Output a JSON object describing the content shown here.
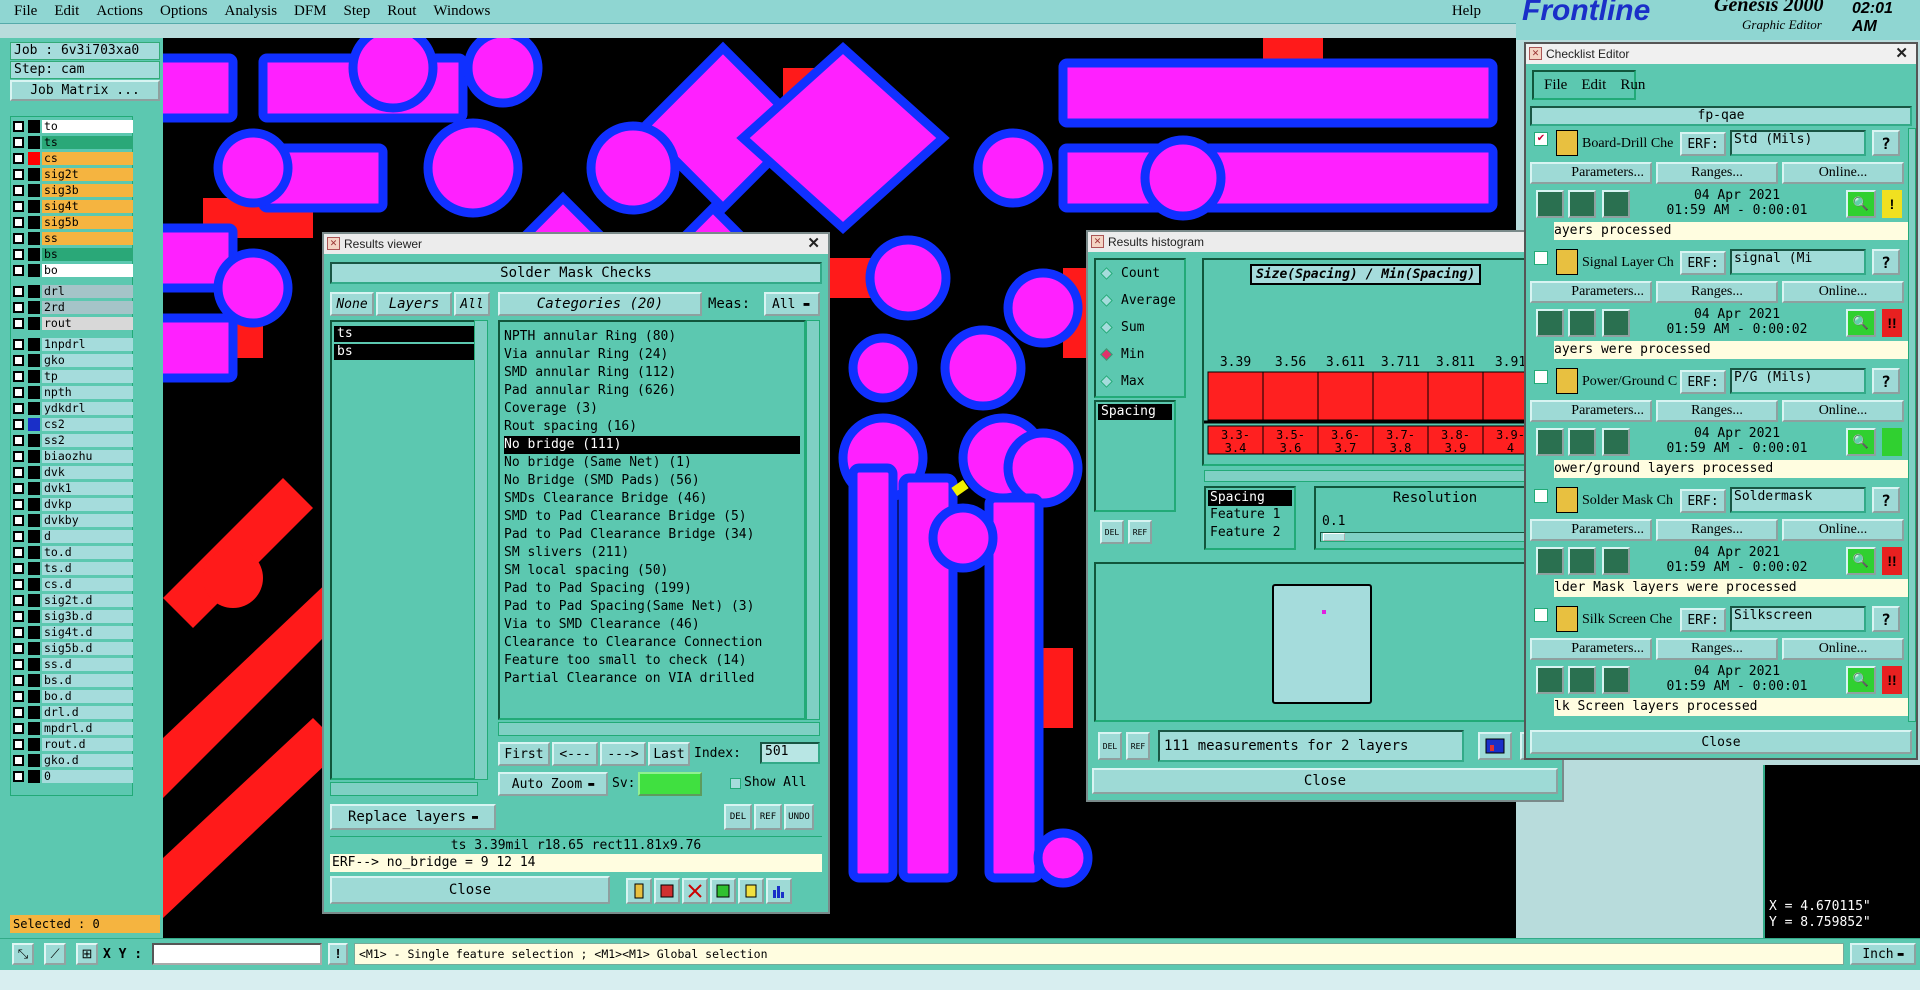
{
  "menubar": {
    "items": [
      "File",
      "Edit",
      "Actions",
      "Options",
      "Analysis",
      "DFM",
      "Step",
      "Rout",
      "Windows"
    ],
    "help": "Help"
  },
  "brand": {
    "logo": "Frontline",
    "product": "Genesis 2000",
    "subtitle": "Graphic Editor",
    "time": "02:01 AM"
  },
  "left": {
    "job": "Job : 6v3i703xa0",
    "step": "Step: cam",
    "job_matrix": "Job Matrix ...",
    "layers": [
      {
        "name": "to",
        "color": "#ffffff",
        "swatch": "#000000"
      },
      {
        "name": "ts",
        "color": "#2aa878",
        "swatch": "#000000"
      },
      {
        "name": "cs",
        "color": "#f5b440",
        "swatch": "#ff0000"
      },
      {
        "name": "sig2t",
        "color": "#f5b440",
        "swatch": "#000000"
      },
      {
        "name": "sig3b",
        "color": "#f5b440",
        "swatch": "#000000"
      },
      {
        "name": "sig4t",
        "color": "#f5b440",
        "swatch": "#000000"
      },
      {
        "name": "sig5b",
        "color": "#f5b440",
        "swatch": "#000000"
      },
      {
        "name": "ss",
        "color": "#f5b440",
        "swatch": "#000000"
      },
      {
        "name": "bs",
        "color": "#2aa878",
        "swatch": "#000000"
      },
      {
        "name": "bo",
        "color": "#ffffff",
        "swatch": "#000000"
      },
      {
        "name": "drl",
        "color": "#a5c4c8",
        "swatch": "#000000"
      },
      {
        "name": "2rd",
        "color": "#a5c4c8",
        "swatch": "#000000"
      },
      {
        "name": "rout",
        "color": "#d8d8d8",
        "swatch": "#000000"
      },
      {
        "name": "1npdrl",
        "color": "#a5dcdc",
        "swatch": "#000000"
      },
      {
        "name": "gko",
        "color": "#a5dcdc",
        "swatch": "#000000"
      },
      {
        "name": "tp",
        "color": "#a5dcdc",
        "swatch": "#000000"
      },
      {
        "name": "npth",
        "color": "#a5dcdc",
        "swatch": "#000000"
      },
      {
        "name": "ydkdrl",
        "color": "#a5dcdc",
        "swatch": "#000000"
      },
      {
        "name": "cs2",
        "color": "#a5dcdc",
        "swatch": "#1a2fc8"
      },
      {
        "name": "ss2",
        "color": "#a5dcdc",
        "swatch": "#000000"
      },
      {
        "name": "biaozhu",
        "color": "#a5dcdc",
        "swatch": "#000000"
      },
      {
        "name": "dvk",
        "color": "#a5dcdc",
        "swatch": "#000000"
      },
      {
        "name": "dvk1",
        "color": "#a5dcdc",
        "swatch": "#000000"
      },
      {
        "name": "dvkp",
        "color": "#a5dcdc",
        "swatch": "#000000"
      },
      {
        "name": "dvkby",
        "color": "#a5dcdc",
        "swatch": "#000000"
      },
      {
        "name": "d",
        "color": "#a5dcdc",
        "swatch": "#000000"
      },
      {
        "name": "to.d",
        "color": "#a5dcdc",
        "swatch": "#000000"
      },
      {
        "name": "ts.d",
        "color": "#a5dcdc",
        "swatch": "#000000"
      },
      {
        "name": "cs.d",
        "color": "#a5dcdc",
        "swatch": "#000000"
      },
      {
        "name": "sig2t.d",
        "color": "#a5dcdc",
        "swatch": "#000000"
      },
      {
        "name": "sig3b.d",
        "color": "#a5dcdc",
        "swatch": "#000000"
      },
      {
        "name": "sig4t.d",
        "color": "#a5dcdc",
        "swatch": "#000000"
      },
      {
        "name": "sig5b.d",
        "color": "#a5dcdc",
        "swatch": "#000000"
      },
      {
        "name": "ss.d",
        "color": "#a5dcdc",
        "swatch": "#000000"
      },
      {
        "name": "bs.d",
        "color": "#a5dcdc",
        "swatch": "#000000"
      },
      {
        "name": "bo.d",
        "color": "#a5dcdc",
        "swatch": "#000000"
      },
      {
        "name": "drl.d",
        "color": "#a5dcdc",
        "swatch": "#000000"
      },
      {
        "name": "mpdrl.d",
        "color": "#a5dcdc",
        "swatch": "#000000"
      },
      {
        "name": "rout.d",
        "color": "#a5dcdc",
        "swatch": "#000000"
      },
      {
        "name": "gko.d",
        "color": "#a5dcdc",
        "swatch": "#000000"
      },
      {
        "name": "0",
        "color": "#a5dcdc",
        "swatch": "#000000"
      }
    ],
    "selected": "Selected : 0"
  },
  "results_viewer": {
    "title": "Results viewer",
    "header": "Solder Mask Checks",
    "none_btn": "None",
    "layers_btn": "Layers",
    "all_btn": "All",
    "layers": [
      "ts",
      "bs"
    ],
    "categories_btn": "Categories (20)",
    "meas_label": "Meas:",
    "meas_value": "All",
    "categories": [
      "NPTH annular Ring (80)",
      "Via annular Ring (24)",
      "SMD annular Ring (112)",
      "Pad annular Ring (626)",
      "Coverage (3)",
      "Rout spacing (16)",
      "No bridge (111)",
      "No bridge (Same Net) (1)",
      "No Bridge (SMD Pads) (56)",
      "SMDs Clearance Bridge (46)",
      "SMD to Pad Clearance Bridge (5)",
      "Pad to Pad Clearance Bridge (34)",
      "SM slivers (211)",
      "SM local spacing (50)",
      "Pad to Pad Spacing (199)",
      "Pad to Pad Spacing(Same Net) (3)",
      "Via to SMD Clearance (46)",
      "Clearance to Clearance Connection",
      "Feature too small to check (14)",
      "Partial Clearance on VIA drilled"
    ],
    "selected_category": "No bridge (111)",
    "nav": {
      "first": "First",
      "prev": "<---",
      "next": "--->",
      "last": "Last",
      "index_label": "Index:",
      "index_value": "501"
    },
    "auto_zoom": "Auto Zoom",
    "sv_label": "Sv:",
    "show_all": "Show All",
    "replace_layers": "Replace layers",
    "info_line": "ts 3.39mil  r18.65  rect11.81x9.76",
    "erf_line": "ERF--> no_bridge = 9 12 14",
    "close": "Close"
  },
  "histogram": {
    "title": "Results histogram",
    "modes": [
      "Count",
      "Average",
      "Sum",
      "Min",
      "Max"
    ],
    "selected_mode": "Min",
    "list_item": "Spacing",
    "chart_title": "Size(Spacing) / Min(Spacing)",
    "feature_list": [
      "Spacing",
      "Feature 1",
      "Feature 2"
    ],
    "resolution_label": "Resolution",
    "resolution_value": "0.1",
    "status": "111 measurements for 2 layers",
    "close": "Close"
  },
  "chart_data": {
    "type": "bar",
    "title": "Size(Spacing) / Min(Spacing)",
    "categories": [
      "3.3-3.4",
      "3.5-3.6",
      "3.6-3.7",
      "3.7-3.8",
      "3.8-3.9",
      "3.9-4"
    ],
    "bar_labels": [
      "3.39",
      "3.56",
      "3.611",
      "3.711",
      "3.811",
      "3.91"
    ],
    "values": [
      3.39,
      3.56,
      3.611,
      3.711,
      3.811,
      3.91
    ],
    "bar_color": "#ff2020"
  },
  "checklist": {
    "title": "Checklist Editor",
    "menu": [
      "File",
      "Edit",
      "Run"
    ],
    "name": "fp-qae",
    "erf_label": "ERF:",
    "params": "Parameters...",
    "ranges": "Ranges...",
    "online": "Online...",
    "close": "Close",
    "checks": [
      {
        "name": "Board-Drill Che",
        "erf": "Std (Mils)",
        "date": "04 Apr 2021",
        "time": "01:59 AM - 0:00:01",
        "status": "ayers processed",
        "flag": "#f0e020",
        "flag_text": "!"
      },
      {
        "name": "Signal Layer Ch",
        "erf": "signal (Mi",
        "date": "04 Apr 2021",
        "time": "01:59 AM - 0:00:02",
        "status": "ayers were processed",
        "flag": "#e82020",
        "flag_text": "!!"
      },
      {
        "name": "Power/Ground C",
        "erf": "P/G (Mils)",
        "date": "04 Apr 2021",
        "time": "01:59 AM - 0:00:01",
        "status": "ower/ground layers processed",
        "flag": "#30d030",
        "flag_text": ""
      },
      {
        "name": "Solder Mask Ch",
        "erf": "Soldermask",
        "date": "04 Apr 2021",
        "time": "01:59 AM - 0:00:02",
        "status": "lder Mask layers were processed",
        "flag": "#e82020",
        "flag_text": "!!"
      },
      {
        "name": "Silk Screen Che",
        "erf": "Silkscreen",
        "date": "04 Apr 2021",
        "time": "01:59 AM - 0:00:01",
        "status": "lk Screen layers processed",
        "flag": "#e82020",
        "flag_text": "!!"
      }
    ]
  },
  "coords": {
    "x": "X = 4.670115\"",
    "y": "Y = 8.759852\""
  },
  "status": {
    "xy_label": "X Y :",
    "message": "<M1> - Single feature selection ; <M1><M1> Global selection",
    "unit": "Inch"
  }
}
